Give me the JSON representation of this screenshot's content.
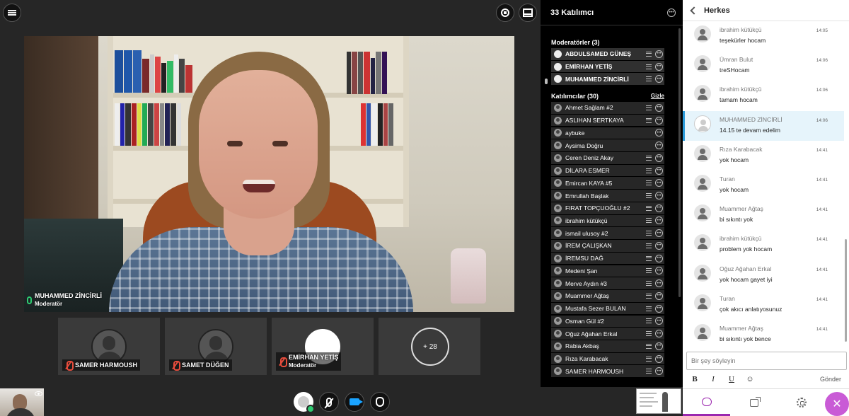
{
  "participants": {
    "title": "33 Katılımcı",
    "moderators_header": "Moderatörler (3)",
    "attendees_header": "Katılımcılar (30)",
    "hide_label": "Gizle",
    "moderators": [
      {
        "name": "ABDULSAMED GÜNEŞ"
      },
      {
        "name": "EMİRHAN YETİŞ"
      },
      {
        "name": "MUHAMMED ZİNCİRLİ"
      }
    ],
    "attendees": [
      {
        "name": "Ahmet Sağlam #2"
      },
      {
        "name": "ASLIHAN SERTKAYA"
      },
      {
        "name": "aybuke"
      },
      {
        "name": "Aysima Doğru"
      },
      {
        "name": "Ceren Deniz Akay"
      },
      {
        "name": "DİLARA ESMER"
      },
      {
        "name": "Emircan KAYA #5"
      },
      {
        "name": "Emrullah Başlak"
      },
      {
        "name": "FIRAT TOPÇUOĞLU #2"
      },
      {
        "name": "ibrahim kütükçü"
      },
      {
        "name": "ismail ulusoy #2"
      },
      {
        "name": "İREM ÇALIŞKAN"
      },
      {
        "name": "İREMSU DAĞ"
      },
      {
        "name": "Medeni Şan"
      },
      {
        "name": "Merve Aydın #3"
      },
      {
        "name": "Muammer Ağtaş"
      },
      {
        "name": "Mustafa Sezer BULAN"
      },
      {
        "name": "Osman Gül #2"
      },
      {
        "name": "Oğuz Ağahan Erkal"
      },
      {
        "name": "Rabia Akbaş"
      },
      {
        "name": "Rıza Karabacak"
      },
      {
        "name": "SAMER HARMOUSH"
      }
    ]
  },
  "stage": {
    "main_speaker": {
      "name": "MUHAMMED ZİNCİRLİ",
      "role": "Moderatör"
    },
    "tiles": [
      {
        "name": "SAMER HARMOUSH",
        "role": ""
      },
      {
        "name": "SAMET DÜĞEN",
        "role": ""
      },
      {
        "name": "EMİRHAN YETİŞ",
        "role": "Moderatör"
      }
    ],
    "more_count": "+ 28"
  },
  "chat": {
    "title": "Herkes",
    "messages": [
      {
        "author": "ibrahim kütükçü",
        "text": "teşekürler hocam",
        "time": "14:05"
      },
      {
        "author": "Ümran Bulut",
        "text": "treSHocam",
        "time": "14:06"
      },
      {
        "author": "ibrahim kütükçü",
        "text": "tamam hocam",
        "time": "14:06"
      },
      {
        "author": "MUHAMMED ZİNCİRLİ",
        "text": "14.15 te devam edelim",
        "time": "14:06",
        "highlight": true
      },
      {
        "author": "Rıza Karabacak",
        "text": "yok hocam",
        "time": "14:41"
      },
      {
        "author": "Turan",
        "text": "yok hocam",
        "time": "14:41"
      },
      {
        "author": "Muammer Ağtaş",
        "text": "bi sıkıntı yok",
        "time": "14:41"
      },
      {
        "author": "ibrahim kütükçü",
        "text": "problem yok hocam",
        "time": "14:41"
      },
      {
        "author": "Oğuz Ağahan Erkal",
        "text": "yok hocam gayet iyi",
        "time": "14:41"
      },
      {
        "author": "Turan",
        "text": "çok akıcı anlatıyosunuz",
        "time": "14:41"
      },
      {
        "author": "Muammer Ağtaş",
        "text": "bi sıkıntı yok bence",
        "time": "14:41"
      }
    ],
    "input_placeholder": "Bir şey söyleyin",
    "format": {
      "bold": "B",
      "italic": "I",
      "underline": "U"
    },
    "send_label": "Gönder"
  },
  "colors": {
    "accent": "#9b27af",
    "highlight": "#2d9cdb",
    "mic_on": "#2ecc71",
    "mic_off": "#e74c3c"
  }
}
